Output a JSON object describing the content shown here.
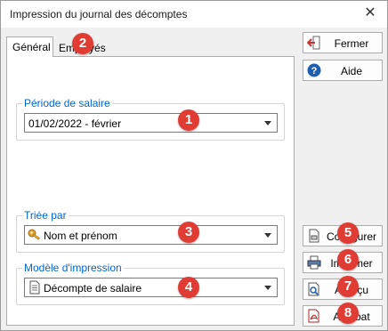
{
  "window": {
    "title": "Impression du journal des décomptes"
  },
  "tabs": [
    {
      "label": "Général"
    },
    {
      "label": "Employés"
    }
  ],
  "groups": {
    "period": {
      "legend": "Période de salaire",
      "value": "01/02/2022 - février"
    },
    "sort": {
      "legend": "Triée par",
      "value": "Nom et prénom"
    },
    "model": {
      "legend": "Modèle d'impression",
      "value": "Décompte de salaire"
    }
  },
  "buttons": {
    "close": "Fermer",
    "help": "Aide",
    "configure": "Configurer",
    "print": "Imprimer",
    "preview": "Aperçu",
    "pdf": "Acrobat"
  },
  "badges": [
    "1",
    "2",
    "3",
    "4",
    "5",
    "6",
    "7",
    "8"
  ],
  "colors": {
    "badge": "#e03c34",
    "legend": "#0066cc"
  }
}
